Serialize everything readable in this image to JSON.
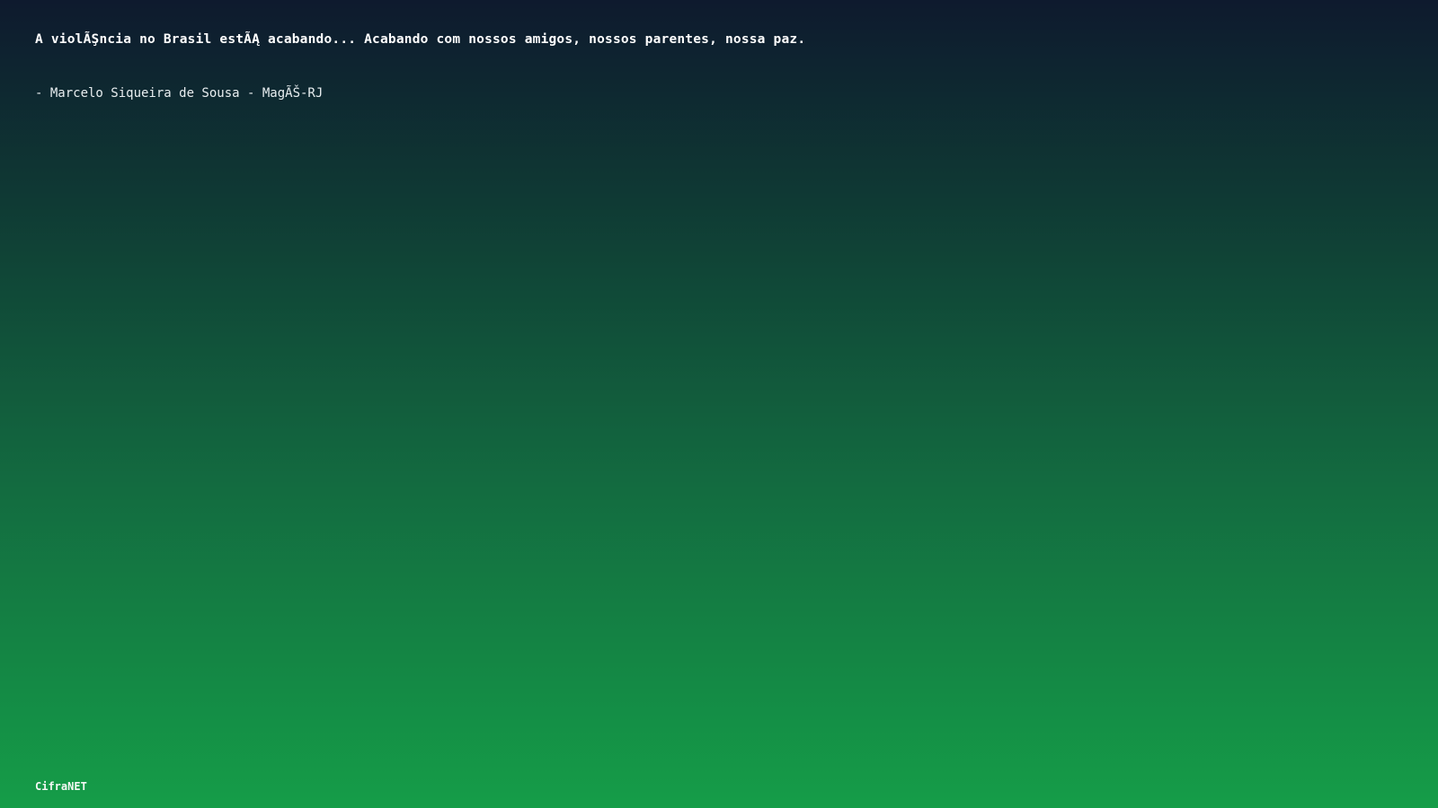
{
  "quote": {
    "text": "A violÃŞncia no Brasil estÃĄ acabando... Acabando com nossos amigos, nossos parentes, nossa paz.",
    "author": "- Marcelo Siqueira de Sousa - MagÃŠ-RJ"
  },
  "footer": {
    "brand": "CifraNET"
  },
  "colors": {
    "gradient_top": "#0e1a2e",
    "gradient_bottom": "#159d48",
    "text": "#ffffff"
  }
}
